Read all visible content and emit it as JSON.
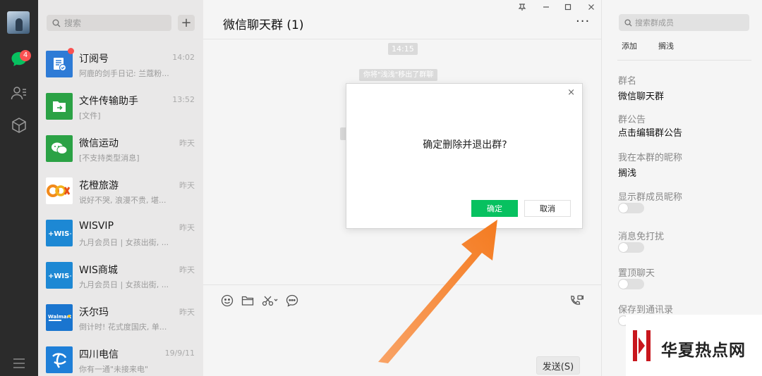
{
  "nav": {
    "unread_badge": "4"
  },
  "convlist": {
    "search_placeholder": "搜索",
    "add_symbol": "+",
    "items": [
      {
        "name": "订阅号",
        "time": "14:02",
        "preview": "阿鹿的剑手日记: 兰蔻粉...",
        "icon": "subscription-icon",
        "color": "#2e7bd6"
      },
      {
        "name": "文件传输助手",
        "time": "13:52",
        "preview": "[文件]",
        "icon": "file-transfer-icon",
        "color": "#2ba245"
      },
      {
        "name": "微信运动",
        "time": "昨天",
        "preview": "[不支持类型消息]",
        "icon": "wechat-sport-icon",
        "color": "#2ba245"
      },
      {
        "name": "花橙旅游",
        "time": "昨天",
        "preview": "说好不哭, 浪漫不贵, 堪...",
        "icon": "huacheng-logo",
        "color": "#f28a1b"
      },
      {
        "name": "WISVIP",
        "time": "昨天",
        "preview": "九月会员日 | 女孩出街, ...",
        "icon": "wis-logo",
        "color": "#1d88d4"
      },
      {
        "name": "WIS商城",
        "time": "昨天",
        "preview": "九月会员日 | 女孩出街, ...",
        "icon": "wis-logo",
        "color": "#1d88d4"
      },
      {
        "name": "沃尔玛",
        "time": "昨天",
        "preview": "倒计时! 花式度国庆, 单...",
        "icon": "walmart-logo",
        "color": "#1a75cf"
      },
      {
        "name": "四川电信",
        "time": "19/9/11",
        "preview": "你有一通\"未接来电\"",
        "icon": "telecom-logo",
        "color": "#1e7fd8"
      }
    ]
  },
  "chat": {
    "title": "微信聊天群 (1)",
    "more": "···",
    "window_controls": {
      "pin": "ꝏ",
      "minimize": "—",
      "maximize": "☐",
      "close": "✕"
    },
    "system_time": "14:15",
    "system_message": "你将\"浅浅\"移出了群聊",
    "send_label": "发送(S)"
  },
  "dialog": {
    "close": "×",
    "message": "确定删除并退出群?",
    "ok_label": "确定",
    "cancel_label": "取消"
  },
  "info": {
    "search_placeholder": "搜索群成员",
    "members": [
      "添加",
      "搁浅"
    ],
    "group_name_label": "群名",
    "group_name": "微信聊天群",
    "notice_label": "群公告",
    "notice_value": "点击编辑群公告",
    "nickname_label": "我在本群的昵称",
    "nickname_value": "搁浅",
    "show_nick_label": "显示群成员昵称",
    "mute_label": "消息免打扰",
    "pin_label": "置顶聊天",
    "save_label": "保存到通讯录"
  },
  "watermark": {
    "text": "华夏热点网"
  },
  "colors": {
    "accent": "#07c160",
    "arrow": "#f47b20",
    "badge": "#fa5151"
  }
}
